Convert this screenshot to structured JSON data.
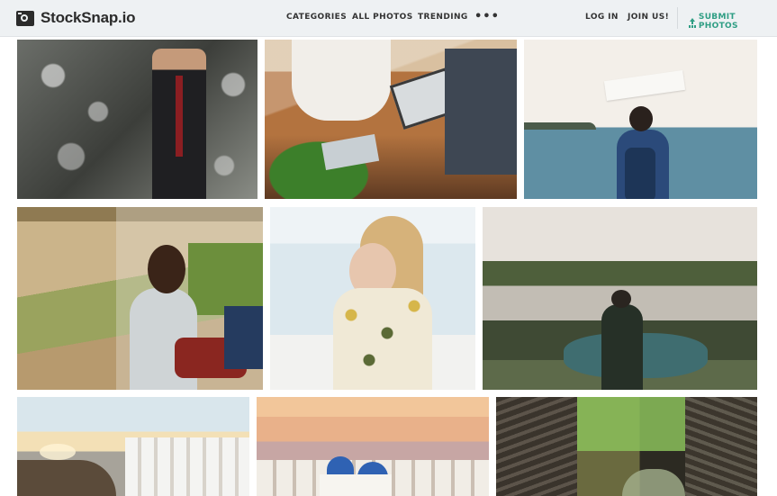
{
  "brand": {
    "name": "StockSnap.io",
    "icon": "camera-logo-icon"
  },
  "nav": {
    "categories": "CATEGORIES",
    "all_photos": "ALL PHOTOS",
    "trending": "TRENDING",
    "more": "•••",
    "login": "LOG IN",
    "join": "JOIN US!",
    "submit": "SUBMIT PHOTOS"
  },
  "colors": {
    "accent": "#2f9e84",
    "header_bg": "#eef1f3",
    "text": "#333333"
  },
  "photos": [
    {
      "subject": "businessman in suit looking at phone"
    },
    {
      "subject": "people working at table with laptop and tablet"
    },
    {
      "subject": "woman with backpack holding fabric over sea"
    },
    {
      "subject": "woman with sunglasses riding in cart"
    },
    {
      "subject": "blonde woman in floral shirt holding phone"
    },
    {
      "subject": "hiker with backpack photographing lake canyon"
    },
    {
      "subject": "coastal white village at sunset"
    },
    {
      "subject": "blue domed church at sunset"
    },
    {
      "subject": "forest creek gorge with rocky walls"
    }
  ]
}
